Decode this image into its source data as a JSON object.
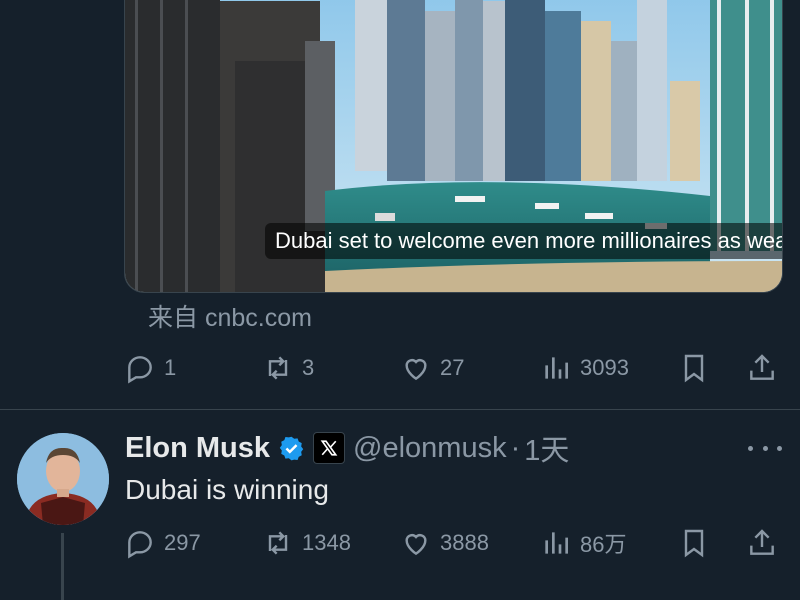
{
  "link_card": {
    "title": "Dubai set to welcome even more millionaires as weal...",
    "source": "来自 cnbc.com"
  },
  "first_actions": {
    "reply": {
      "icon": "reply-icon",
      "count": "1"
    },
    "repost": {
      "icon": "repost-icon",
      "count": "3"
    },
    "like": {
      "icon": "heart-icon",
      "count": "27"
    },
    "views": {
      "icon": "views-icon",
      "count": "3093"
    },
    "bookmark": {
      "icon": "bookmark-icon"
    },
    "share": {
      "icon": "share-icon"
    }
  },
  "tweet": {
    "display_name": "Elon Musk",
    "verified_icon": "verified-badge-icon",
    "affiliate_icon": "x-logo-icon",
    "handle": "@elonmusk",
    "separator": "·",
    "time": "1天",
    "text": "Dubai is winning",
    "actions": {
      "reply": {
        "icon": "reply-icon",
        "count": "297"
      },
      "repost": {
        "icon": "repost-icon",
        "count": "1348"
      },
      "like": {
        "icon": "heart-icon",
        "count": "3888"
      },
      "views": {
        "icon": "views-icon",
        "count": "86万"
      },
      "bookmark": {
        "icon": "bookmark-icon"
      },
      "share": {
        "icon": "share-icon"
      }
    }
  },
  "colors": {
    "background": "#15202b",
    "text_primary": "#e7e9ea",
    "text_secondary": "#8b98a5",
    "border": "#38444d",
    "verified_blue": "#1d9bf0"
  }
}
